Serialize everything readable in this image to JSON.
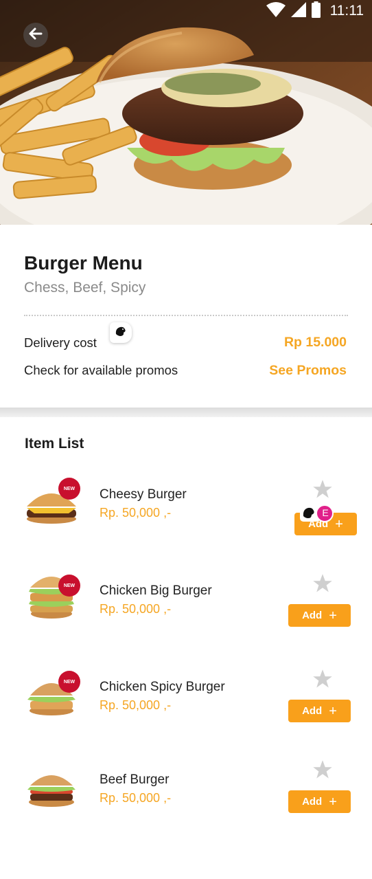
{
  "status_bar": {
    "time": "11:11",
    "icons": [
      "wifi-icon",
      "signal-icon",
      "battery-icon"
    ]
  },
  "header": {
    "back_icon": "arrow-left-icon"
  },
  "menu": {
    "title": "Burger Menu",
    "subtitle": "Chess, Beef, Spicy",
    "delivery_label": "Delivery cost",
    "delivery_value": "Rp 15.000",
    "promo_label": "Check for available promos",
    "promo_link": "See Promos"
  },
  "list": {
    "title": "Item List",
    "add_label": "Add",
    "new_label": "NEW",
    "items": [
      {
        "name": "Cheesy Burger",
        "price": "Rp. 50,000 ,-",
        "is_new": true
      },
      {
        "name": "Chicken Big Burger",
        "price": "Rp. 50,000 ,-",
        "is_new": true
      },
      {
        "name": "Chicken Spicy Burger",
        "price": "Rp. 50,000 ,-",
        "is_new": true
      },
      {
        "name": "Beef Burger",
        "price": "Rp. 50,000 ,-",
        "is_new": false
      }
    ]
  },
  "overlay": {
    "avatar_letter": "E"
  },
  "colors": {
    "accent": "#f5a623",
    "button": "#f9a01b",
    "badge": "#c8102e",
    "star": "#cfcfcf",
    "avatar": "#e0208a"
  }
}
